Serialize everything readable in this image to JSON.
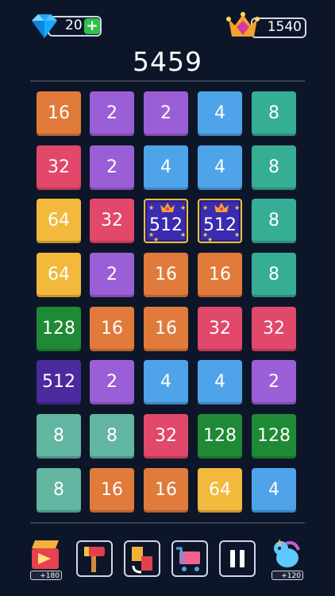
{
  "hud": {
    "gems": "20",
    "plus": "+",
    "crowns": "1540"
  },
  "score": "5459",
  "board": {
    "rows": [
      [
        "16",
        "2",
        "2",
        "4",
        "8"
      ],
      [
        "32",
        "2",
        "4",
        "4",
        "8"
      ],
      [
        "64",
        "32",
        "512",
        "512",
        "8"
      ],
      [
        "64",
        "2",
        "16",
        "16",
        "8"
      ],
      [
        "128",
        "16",
        "16",
        "32",
        "32"
      ],
      [
        "512",
        "2",
        "4",
        "4",
        "2"
      ],
      [
        "8",
        "8",
        "32",
        "128",
        "128"
      ],
      [
        "8",
        "16",
        "16",
        "64",
        "4"
      ]
    ],
    "special_tiles": [
      "2-2",
      "2-3"
    ]
  },
  "tile_colors": {
    "2": "#9a5fd6",
    "4": "#4fa3e8",
    "8": "#36ad95",
    "16": "#e07b3c",
    "32": "#e2486a",
    "64": "#f2b93c",
    "128": "#1f8a35",
    "512": "#4b2a9e"
  },
  "tile_colors_overrides": {
    "6-0": "#63b6a1",
    "7-0": "#63b6a1",
    "6-1": "#63b6a1"
  },
  "toolbar": {
    "left_reward": "+180",
    "right_reward": "+120",
    "buttons": [
      "hammer-icon",
      "swap-icon",
      "shop-cart-icon",
      "pause-icon"
    ]
  }
}
